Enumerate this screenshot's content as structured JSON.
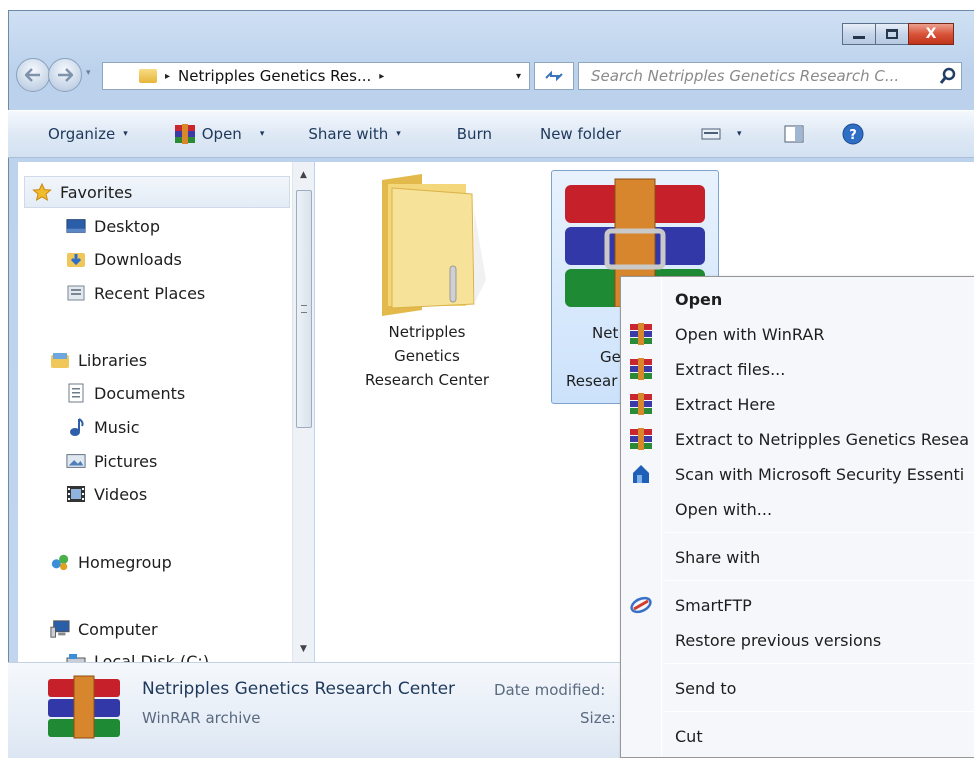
{
  "window": {
    "caption_buttons": [
      "minimize",
      "maximize",
      "close"
    ],
    "close_glyph": "X"
  },
  "address_bar": {
    "back_icon": "back-arrow-icon",
    "forward_icon": "forward-arrow-icon",
    "path_separator": "▸",
    "path": "Netripples Genetics Res...",
    "dropdown": "▾",
    "refresh_icon": "refresh-icon"
  },
  "search": {
    "placeholder": "Search Netripples Genetics Research C..."
  },
  "toolbar": {
    "organize": "Organize",
    "open": "Open",
    "share_with": "Share with",
    "burn": "Burn",
    "new_folder": "New folder",
    "caret": "▾"
  },
  "navigation": {
    "favorites": "Favorites",
    "desktop": "Desktop",
    "downloads": "Downloads",
    "recent_places": "Recent Places",
    "libraries": "Libraries",
    "documents": "Documents",
    "music": "Music",
    "pictures": "Pictures",
    "videos": "Videos",
    "homegroup": "Homegroup",
    "computer": "Computer",
    "local_disk": "Local Disk (C:)"
  },
  "content": {
    "folder_label_lines": [
      "Netripples",
      "Genetics",
      "Research Center"
    ],
    "archive_label_lines": [
      "Net",
      "Ge",
      "Resear"
    ]
  },
  "details": {
    "name": "Netripples Genetics Research Center",
    "type": "WinRAR archive",
    "date_modified_label": "Date modified:",
    "size_label": "Size:"
  },
  "context_menu": {
    "items": [
      {
        "label": "Open",
        "icon": "",
        "bold": true
      },
      {
        "label": "Open with WinRAR",
        "icon": "winrar-icon"
      },
      {
        "label": "Extract files...",
        "icon": "winrar-icon"
      },
      {
        "label": "Extract Here",
        "icon": "winrar-icon"
      },
      {
        "label": "Extract to Netripples Genetics Resea",
        "icon": "winrar-icon"
      },
      {
        "label": "Scan with Microsoft Security Essenti",
        "icon": "mse-shield-icon"
      },
      {
        "label": "Open with...",
        "icon": ""
      },
      {
        "label": "Share with",
        "icon": ""
      },
      {
        "label": "SmartFTP",
        "icon": "smartftp-icon"
      },
      {
        "label": "Restore previous versions",
        "icon": ""
      },
      {
        "label": "Send to",
        "icon": ""
      },
      {
        "label": "Cut",
        "icon": ""
      }
    ]
  },
  "colors": {
    "frame": "#bcd2ec",
    "toolbar_text": "#1e395b",
    "selection": "#cce2fb"
  }
}
